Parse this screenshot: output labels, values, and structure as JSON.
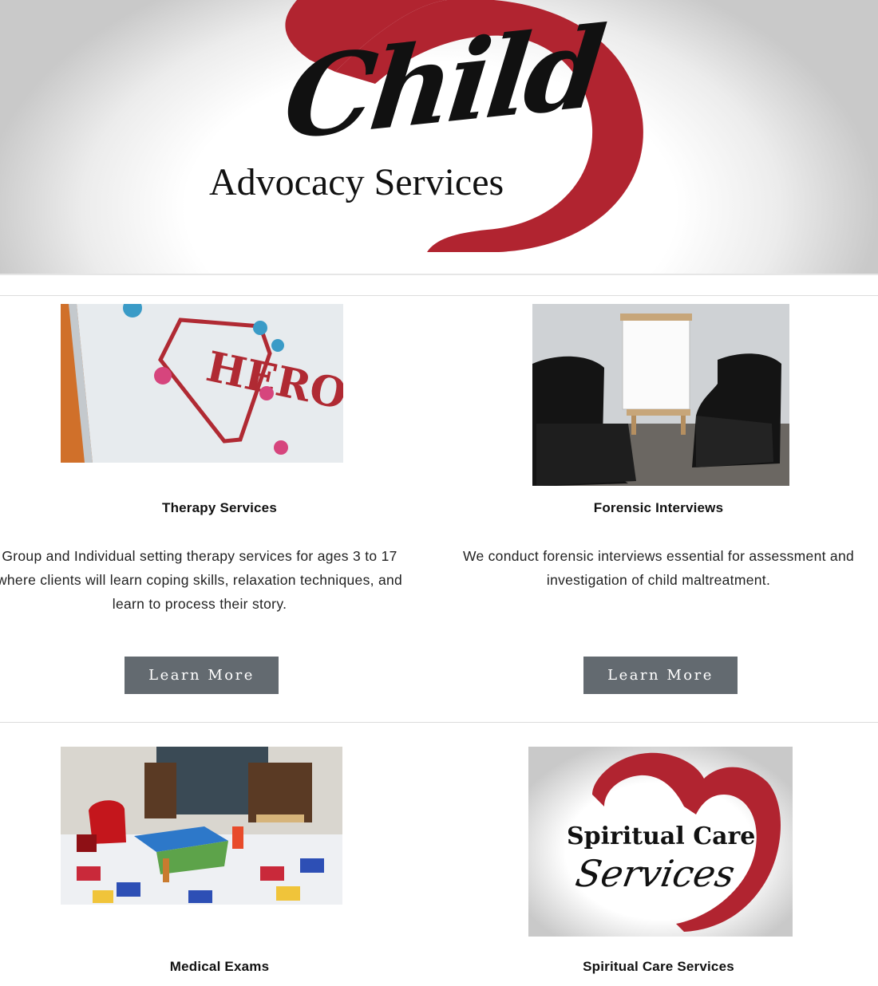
{
  "hero": {
    "logo_script": "Child",
    "logo_sub": "Advocacy Services",
    "brand_red": "#b12430"
  },
  "services": [
    {
      "title": "Therapy Services",
      "description": "Group and Individual setting therapy services for ages 3 to 17 where clients will learn  coping skills, relaxation techniques, and learn to process their story.",
      "button": "Learn More",
      "image": "hero-wall-mural-photo"
    },
    {
      "title": "Forensic Interviews",
      "description": "We conduct forensic interviews essential for assessment and investigation of child maltreatment.",
      "button": "Learn More",
      "image": "interview-room-photo"
    },
    {
      "title": "Medical Exams",
      "image": "playroom-photo"
    },
    {
      "title": "Spiritual Care Services",
      "image": "spiritual-care-logo",
      "logo_line1": "Spiritual Care",
      "logo_line2": "Services"
    }
  ],
  "colors": {
    "button_bg": "#636a70",
    "button_text": "#ffffff",
    "divider": "#dcdcdc"
  }
}
